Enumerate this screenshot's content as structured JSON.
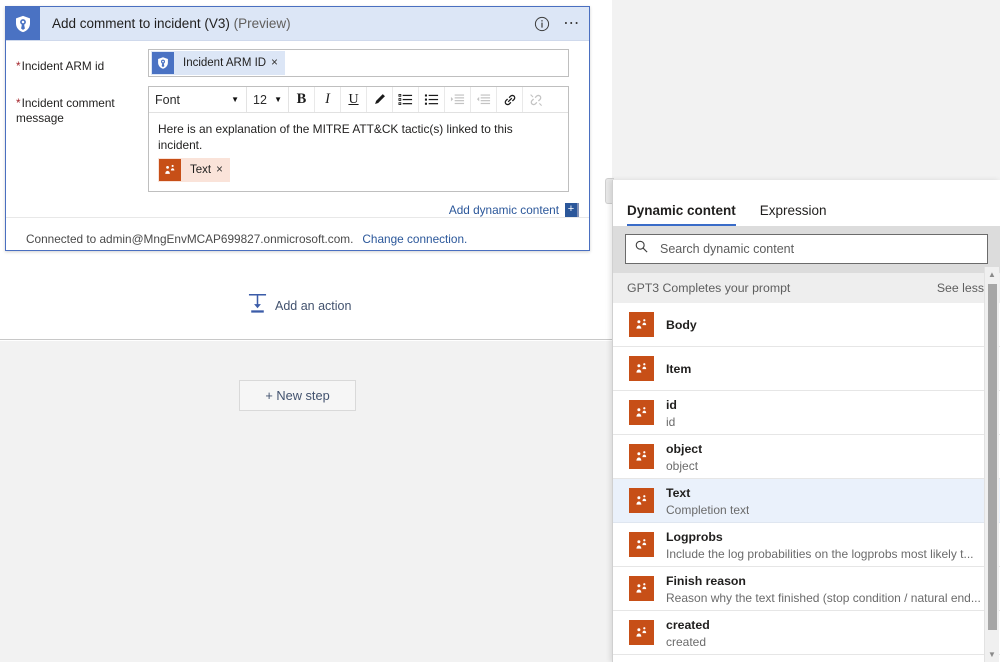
{
  "card": {
    "icon": "sentinel-shield-icon",
    "title": "Add comment to incident (V3)",
    "preview_tag": "(Preview)",
    "info_icon": "info-circle-icon",
    "more_icon": "ellipsis-icon",
    "fields": {
      "arm_id": {
        "label": "Incident ARM id",
        "required": true,
        "token": {
          "label": "Incident ARM ID",
          "remove": "×",
          "icon": "sentinel-shield-icon"
        }
      },
      "comment_message": {
        "label": "Incident comment message",
        "required": true,
        "toolbar": {
          "font_name": "Font",
          "font_size": "12",
          "caret": "▼",
          "buttons": [
            {
              "name": "bold-button",
              "glyph": "B",
              "disabled": false
            },
            {
              "name": "italic-button",
              "glyph": "I",
              "disabled": false
            },
            {
              "name": "underline-button",
              "glyph": "U",
              "disabled": false
            },
            {
              "name": "highlight-color-button",
              "glyph": "pen",
              "disabled": false
            },
            {
              "name": "numbered-list-button",
              "glyph": "ol",
              "disabled": false
            },
            {
              "name": "bulleted-list-button",
              "glyph": "ul",
              "disabled": false
            },
            {
              "name": "increase-indent-button",
              "glyph": "indent",
              "disabled": true
            },
            {
              "name": "decrease-indent-button",
              "glyph": "outdent",
              "disabled": true
            },
            {
              "name": "insert-link-button",
              "glyph": "link",
              "disabled": false
            },
            {
              "name": "remove-link-button",
              "glyph": "unlink",
              "disabled": true
            }
          ]
        },
        "body_text": "Here is an explanation of the MITRE ATT&CK tactic(s) linked to this incident.",
        "token": {
          "label": "Text",
          "remove": "×",
          "icon": "dynamic-content-icon"
        }
      }
    },
    "add_dynamic_content": {
      "label": "Add dynamic content",
      "button_glyph": "+"
    },
    "footer": {
      "connected_text": "Connected to admin@MngEnvMCAP699827.onmicrosoft.com.",
      "change_connection": "Change connection."
    }
  },
  "canvas": {
    "add_action": {
      "label": "Add an action",
      "icon": "insert-action-icon"
    },
    "new_step": {
      "label": "+ New step"
    }
  },
  "dynamic_panel": {
    "tabs": [
      {
        "label": "Dynamic content",
        "active": true
      },
      {
        "label": "Expression",
        "active": false
      }
    ],
    "search": {
      "placeholder": "Search dynamic content",
      "value": "",
      "icon": "search-icon"
    },
    "group": {
      "label": "GPT3 Completes your prompt",
      "toggle": "See less"
    },
    "items": [
      {
        "title": "Body",
        "subtitle": "",
        "selected": false
      },
      {
        "title": "Item",
        "subtitle": "",
        "selected": false
      },
      {
        "title": "id",
        "subtitle": "id",
        "selected": false
      },
      {
        "title": "object",
        "subtitle": "object",
        "selected": false
      },
      {
        "title": "Text",
        "subtitle": "Completion text",
        "selected": true
      },
      {
        "title": "Logprobs",
        "subtitle": "Include the log probabilities on the logprobs most likely t...",
        "selected": false
      },
      {
        "title": "Finish reason",
        "subtitle": "Reason why the text finished (stop condition / natural end...",
        "selected": false
      },
      {
        "title": "created",
        "subtitle": "created",
        "selected": false
      }
    ],
    "scrollbar": {
      "up": "▲",
      "down": "▼"
    }
  },
  "colors": {
    "card_border": "#4a6fc0",
    "header_bg": "#dce6f6",
    "sentinel_blue": "#4a72c3",
    "token_orange": "#c74f17",
    "token_orange_bg": "#fae3d9",
    "link_blue": "#2b579a",
    "tab_underline": "#3a6cc8",
    "selected_row": "#eaf1fb"
  }
}
